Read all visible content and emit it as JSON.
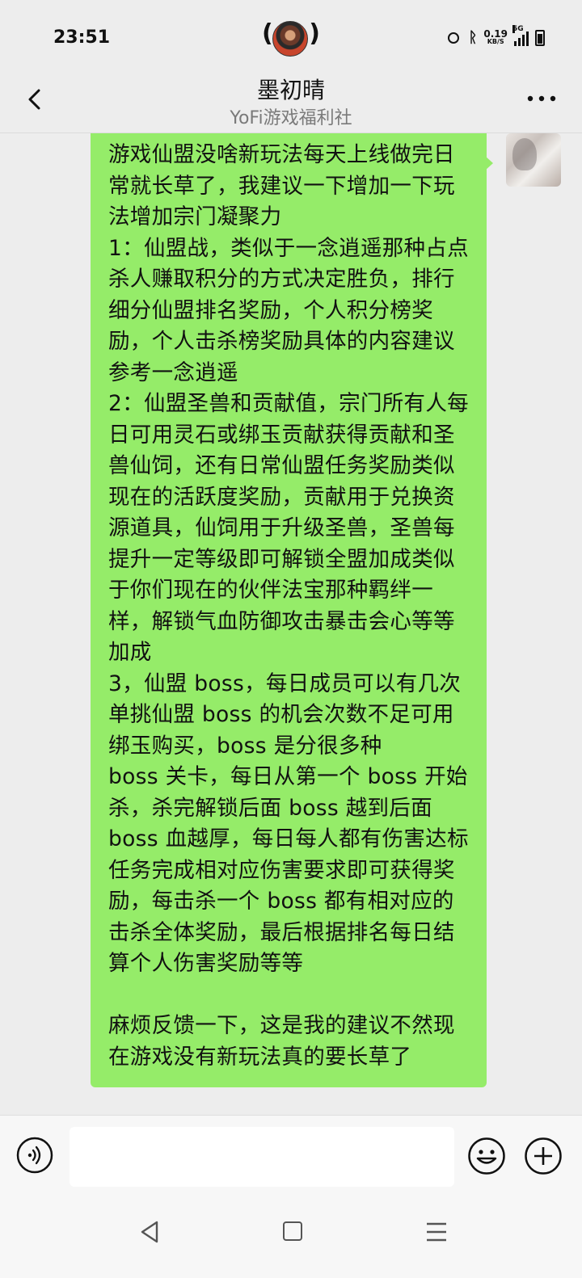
{
  "status_bar": {
    "time": "23:51",
    "net_speed": "0.19",
    "net_unit": "KB/S",
    "network_type": "5G"
  },
  "header": {
    "title": "墨初晴",
    "subtitle": "YoFi游戏福利社"
  },
  "message": {
    "text": "游戏仙盟没啥新玩法每天上线做完日常就长草了，我建议一下增加一下玩法增加宗门凝聚力\n1：仙盟战，类似于一念逍遥那种占点杀人赚取积分的方式决定胜负，排行细分仙盟排名奖励，个人积分榜奖励，个人击杀榜奖励具体的内容建议参考一念逍遥\n2：仙盟圣兽和贡献值，宗门所有人每日可用灵石或绑玉贡献获得贡献和圣兽仙饲，还有日常仙盟任务奖励类似现在的活跃度奖励，贡献用于兑换资源道具，仙饲用于升级圣兽，圣兽每提升一定等级即可解锁全盟加成类似于你们现在的伙伴法宝那种羁绊一样，解锁气血防御攻击暴击会心等等加成\n3，仙盟 boss，每日成员可以有几次单挑仙盟 boss 的机会次数不足可用绑玉购买，boss 是分很多种\nboss 关卡，每日从第一个 boss 开始杀，杀完解锁后面 boss 越到后面 boss 血越厚，每日每人都有伤害达标任务完成相对应伤害要求即可获得奖励，每击杀一个 boss 都有相对应的击杀全体奖励，最后根据排名每日结算个人伤害奖励等等\n\n麻烦反馈一下，这是我的建议不然现在游戏没有新玩法真的要长草了"
  },
  "input": {
    "placeholder": ""
  },
  "colors": {
    "bubble": "#95ec69",
    "background": "#ededed"
  }
}
